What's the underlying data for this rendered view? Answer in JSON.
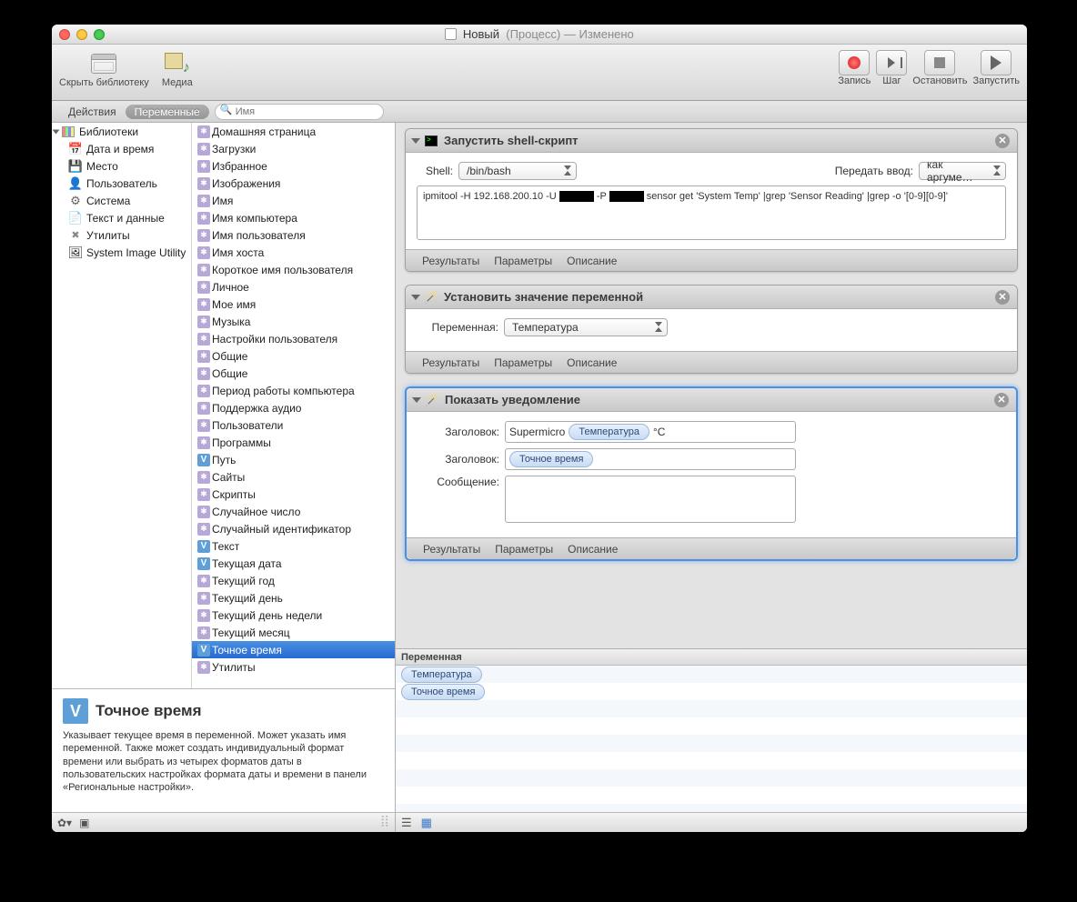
{
  "title": {
    "doc": "Новый",
    "type": "(Процесс)",
    "state": "— Изменено"
  },
  "toolbar": {
    "hide_library": "Скрыть библиотеку",
    "media": "Медиа",
    "record": "Запись",
    "step": "Шаг",
    "stop": "Остановить",
    "run": "Запустить"
  },
  "segmented": {
    "actions": "Действия",
    "variables": "Переменные"
  },
  "search_placeholder": "Имя",
  "categories": [
    {
      "label": "Библиотеки",
      "icon": "lib",
      "expandable": true
    },
    {
      "label": "Дата и время",
      "icon": "cal"
    },
    {
      "label": "Место",
      "icon": "disk"
    },
    {
      "label": "Пользователь",
      "icon": "user"
    },
    {
      "label": "Система",
      "icon": "sys"
    },
    {
      "label": "Текст и данные",
      "icon": "doc"
    },
    {
      "label": "Утилиты",
      "icon": "util"
    },
    {
      "label": "System Image Utility",
      "icon": "app"
    }
  ],
  "items": [
    {
      "l": "Домашняя страница",
      "t": "g"
    },
    {
      "l": "Загрузки",
      "t": "g"
    },
    {
      "l": "Избранное",
      "t": "g"
    },
    {
      "l": "Изображения",
      "t": "g"
    },
    {
      "l": "Имя",
      "t": "g"
    },
    {
      "l": "Имя компьютера",
      "t": "g"
    },
    {
      "l": "Имя пользователя",
      "t": "g"
    },
    {
      "l": "Имя хоста",
      "t": "g"
    },
    {
      "l": "Короткое имя пользователя",
      "t": "g"
    },
    {
      "l": "Личное",
      "t": "g"
    },
    {
      "l": "Мое имя",
      "t": "g"
    },
    {
      "l": "Музыка",
      "t": "g"
    },
    {
      "l": "Настройки пользователя",
      "t": "g"
    },
    {
      "l": "Общие",
      "t": "g"
    },
    {
      "l": "Общие",
      "t": "g"
    },
    {
      "l": "Период работы компьютера",
      "t": "g"
    },
    {
      "l": "Поддержка аудио",
      "t": "g"
    },
    {
      "l": "Пользователи",
      "t": "g"
    },
    {
      "l": "Программы",
      "t": "g"
    },
    {
      "l": "Путь",
      "t": "v"
    },
    {
      "l": "Сайты",
      "t": "g"
    },
    {
      "l": "Скрипты",
      "t": "g"
    },
    {
      "l": "Случайное число",
      "t": "g"
    },
    {
      "l": "Случайный идентификатор",
      "t": "g"
    },
    {
      "l": "Текст",
      "t": "v"
    },
    {
      "l": "Текущая дата",
      "t": "v"
    },
    {
      "l": "Текущий год",
      "t": "g"
    },
    {
      "l": "Текущий день",
      "t": "g"
    },
    {
      "l": "Текущий день недели",
      "t": "g"
    },
    {
      "l": "Текущий месяц",
      "t": "g"
    },
    {
      "l": "Точное время",
      "t": "v",
      "sel": true
    },
    {
      "l": "Утилиты",
      "t": "g"
    }
  ],
  "description": {
    "title": "Точное время",
    "text": "Указывает текущее время в переменной. Может указать имя переменной. Также может создать индивидуальный формат времени или выбрать из четырех форматов даты в пользовательских настройках формата даты и времени в панели «Региональные настройки»."
  },
  "actions_workflow": {
    "a1": {
      "title": "Запустить shell-скрипт",
      "shell_label": "Shell:",
      "shell_value": "/bin/bash",
      "pass_label": "Передать ввод:",
      "pass_value": "как аргуме…",
      "script_pre": "ipmitool -H 192.168.200.10 -U ",
      "script_mid": " -P ",
      "script_post": " sensor get 'System Temp' |grep 'Sensor Reading'  |grep -o '[0-9][0-9]'"
    },
    "a2": {
      "title": "Установить значение переменной",
      "var_label": "Переменная:",
      "var_value": "Температура"
    },
    "a3": {
      "title": "Показать уведомление",
      "h1_label": "Заголовок:",
      "h1_pre": "Supermicro",
      "h1_pill": "Температура",
      "h1_post": "°C",
      "h2_label": "Заголовок:",
      "h2_pill": "Точное время",
      "msg_label": "Сообщение:"
    },
    "footer_tabs": {
      "results": "Результаты",
      "params": "Параметры",
      "desc": "Описание"
    }
  },
  "var_table": {
    "header": "Переменная",
    "rows": [
      "Температура",
      "Точное время"
    ]
  }
}
